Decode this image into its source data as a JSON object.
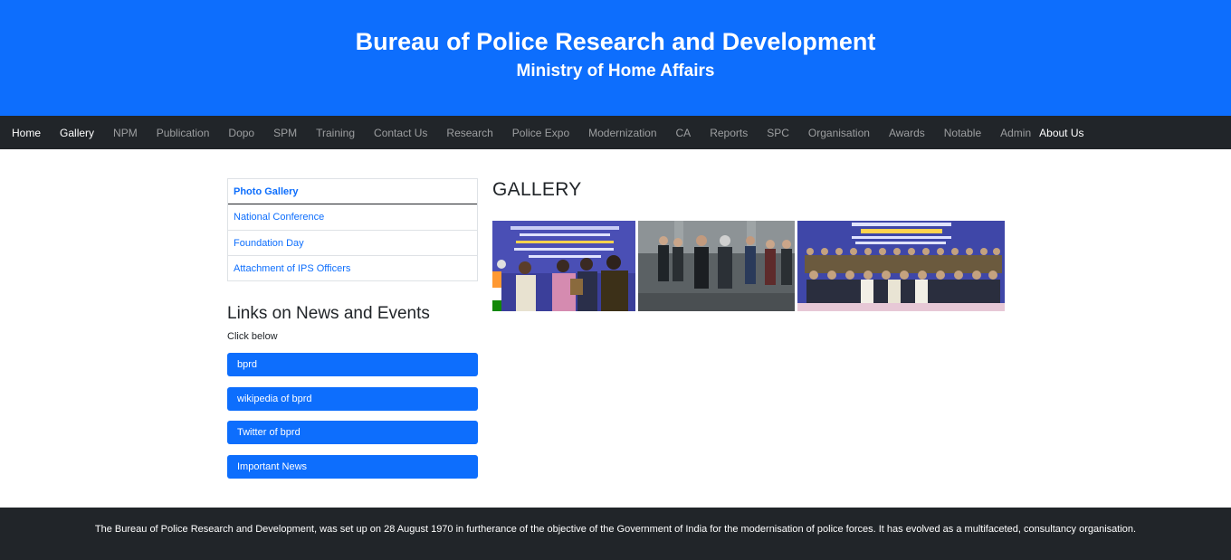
{
  "header": {
    "title": "Bureau of Police Research and Development",
    "subtitle": "Ministry of Home Affairs"
  },
  "nav": {
    "items": [
      "Home",
      "Gallery",
      "NPM",
      "Publication",
      "Dopo",
      "SPM",
      "Training",
      "Contact Us",
      "Research",
      "Police Expo",
      "Modernization",
      "CA",
      "Reports",
      "SPC",
      "Organisation",
      "Awards",
      "Notable",
      "Admin",
      "About Us"
    ]
  },
  "sidebar": {
    "items": [
      "Photo Gallery",
      "National Conference",
      "Foundation Day",
      "Attachment of IPS Officers"
    ]
  },
  "links": {
    "heading": "Links on News and Events",
    "subtext": "Click below",
    "buttons": [
      "bprd",
      "wikipedia of bprd",
      "Twitter of bprd",
      "Important News"
    ]
  },
  "gallery": {
    "heading": "GALLERY",
    "photos": [
      {
        "name": "mou-signing-photo"
      },
      {
        "name": "handshake-photo"
      },
      {
        "name": "foundation-day-group-photo"
      }
    ]
  },
  "footer": {
    "text": "The Bureau of Police Research and Development, was set up on 28 August 1970 in furtherance of the objective of the Government of India for the modernisation of police forces. It has evolved as a multifaceted, consultancy organisation."
  },
  "colors": {
    "brand_blue": "#0d6efd",
    "dark": "#212529"
  }
}
